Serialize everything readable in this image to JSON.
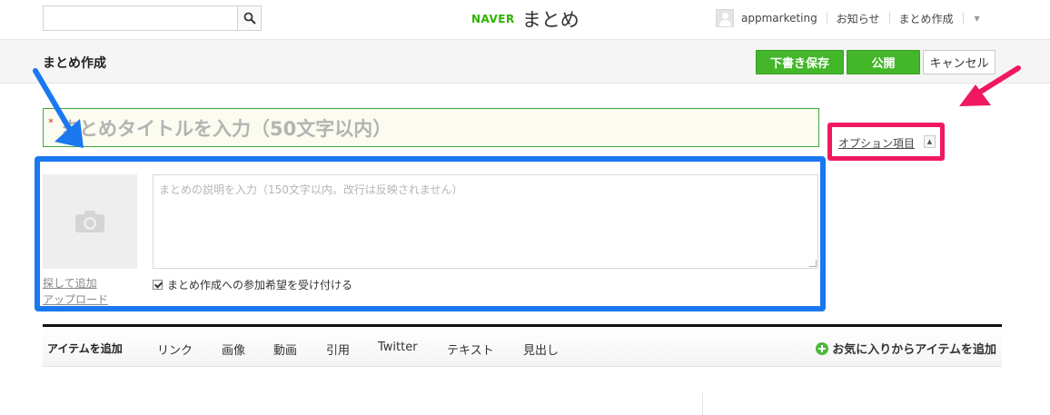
{
  "header": {
    "search": {
      "placeholder": "",
      "value": ""
    },
    "logo": {
      "brand": "NAVER",
      "service": "まとめ"
    },
    "user": {
      "name": "appmarketing"
    },
    "nav": {
      "notices": "お知らせ",
      "create": "まとめ作成"
    }
  },
  "toolbar": {
    "title": "まとめ作成",
    "draft_label": "下書き保存",
    "publish_label": "公開",
    "cancel_label": "キャンセル"
  },
  "form": {
    "required_mark": "*",
    "title_placeholder": "まとめタイトルを入力（50文字以内）",
    "option_label": "オプション項目",
    "description_placeholder": "まとめの説明を入力（150文字以内。改行は反映されません）",
    "photo_search_label": "探して追加",
    "photo_upload_label": "アップロード",
    "accept_participation_label": "まとめ作成への参加希望を受け付ける",
    "accept_participation_checked": true
  },
  "items": {
    "label": "アイテムを追加",
    "tabs": [
      {
        "label": "リンク"
      },
      {
        "label": "画像"
      },
      {
        "label": "動画"
      },
      {
        "label": "引用"
      },
      {
        "label": "Twitter"
      },
      {
        "label": "テキスト"
      },
      {
        "label": "見出し"
      }
    ],
    "favorites_label": "お気に入りからアイテムを追加"
  },
  "icons": {
    "search": "search-icon",
    "avatar": "user-avatar-icon",
    "camera": "camera-icon",
    "plus": "plus-circle-icon",
    "option_toggle": "chevron-up-icon"
  },
  "colors": {
    "accent_green": "#43b62a",
    "title_border": "#3ea63a",
    "highlight_blue": "#1a78f0",
    "highlight_pink": "#f0195f"
  }
}
